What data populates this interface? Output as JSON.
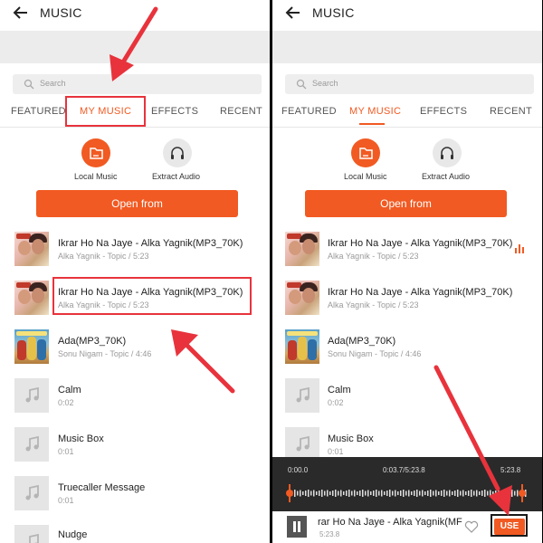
{
  "header": {
    "title": "MUSIC"
  },
  "search": {
    "placeholder": "Search"
  },
  "tabs": [
    {
      "label": "FEATURED"
    },
    {
      "label": "MY MUSIC"
    },
    {
      "label": "EFFECTS"
    },
    {
      "label": "RECENT"
    }
  ],
  "sources": [
    {
      "label": "Local Music",
      "icon": "folder-icon"
    },
    {
      "label": "Extract Audio",
      "icon": "headphones-icon"
    }
  ],
  "open_button": {
    "label": "Open from"
  },
  "tracks": [
    {
      "title": "Ikrar Ho Na Jaye - Alka Yagnik(MP3_70K)",
      "subtitle": "Alka Yagnik - Topic / 5:23"
    },
    {
      "title": "Ikrar Ho Na Jaye - Alka Yagnik(MP3_70K)",
      "subtitle": "Alka Yagnik - Topic / 5:23"
    },
    {
      "title": "Ada(MP3_70K)",
      "subtitle": "Sonu Nigam - Topic / 4:46"
    },
    {
      "title": "Calm",
      "subtitle": "0:02"
    },
    {
      "title": "Music Box",
      "subtitle": "0:01"
    },
    {
      "title": "Truecaller Message",
      "subtitle": "0:01"
    },
    {
      "title": "Nudge",
      "subtitle": ""
    }
  ],
  "player": {
    "start_time": "0:00.0",
    "current_time": "0:03.7/5:23.8",
    "end_time": "5:23.8",
    "now_playing_title": "rar Ho Na Jaye - Alka Yagnik(MF",
    "now_playing_duration": "5:23.8",
    "use_label": "USE"
  },
  "colors": {
    "accent": "#f15a22",
    "annotation": "#e8333c",
    "player_bg": "#2a2a2a"
  }
}
